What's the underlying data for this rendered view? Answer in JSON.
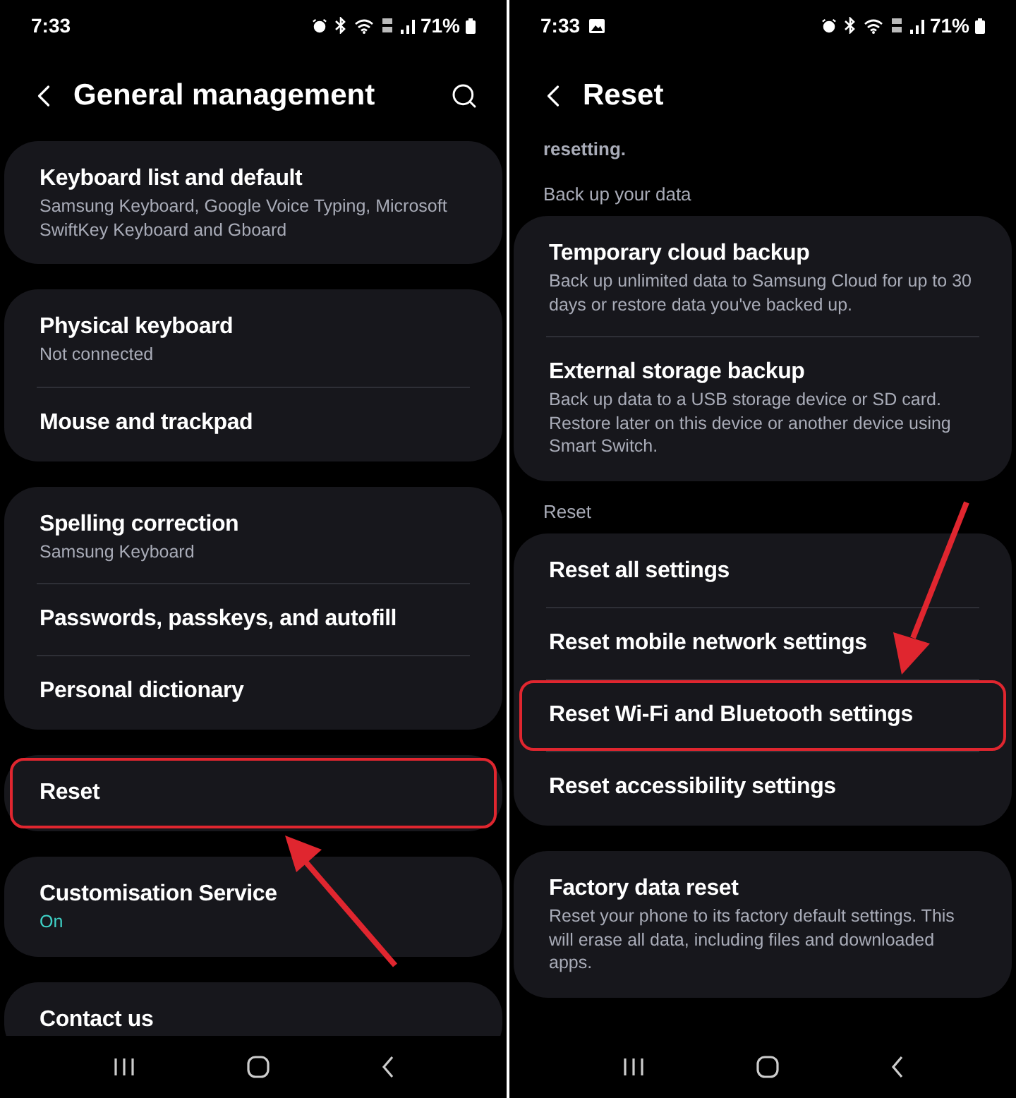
{
  "screens": [
    {
      "status_bar": {
        "time": "7:33",
        "gallery_notification": false,
        "battery": "71%"
      },
      "header": {
        "title": "General management",
        "search": true
      },
      "annotation_arrow": true,
      "content": [
        {
          "kind": "group",
          "items": [
            {
              "title": "Keyboard list and default",
              "subtitle": "Samsung Keyboard, Google Voice Typing, Microsoft SwiftKey Keyboard and Gboard",
              "kind": "info",
              "highlighted": false
            }
          ]
        },
        {
          "kind": "group",
          "items": [
            {
              "title": "Physical keyboard",
              "subtitle": "Not connected",
              "kind": "info",
              "highlighted": false
            },
            {
              "title": "Mouse and trackpad",
              "kind": "info",
              "highlighted": false
            }
          ]
        },
        {
          "kind": "group",
          "items": [
            {
              "title": "Spelling correction",
              "subtitle": "Samsung Keyboard",
              "kind": "info",
              "highlighted": false
            },
            {
              "title": "Passwords, passkeys, and autofill",
              "kind": "info",
              "highlighted": false
            },
            {
              "title": "Personal dictionary",
              "kind": "info",
              "highlighted": false
            }
          ]
        },
        {
          "kind": "group",
          "items": [
            {
              "title": "Reset",
              "kind": "info",
              "highlighted": true
            }
          ]
        },
        {
          "kind": "group",
          "items": [
            {
              "title": "Customisation Service",
              "subtitle": "On",
              "kind": "status",
              "highlighted": false
            }
          ]
        },
        {
          "kind": "group",
          "items": [
            {
              "title": "Contact us",
              "kind": "info",
              "highlighted": false
            }
          ]
        }
      ]
    },
    {
      "status_bar": {
        "time": "7:33",
        "gallery_notification": true,
        "battery": "71%"
      },
      "header": {
        "title": "Reset",
        "search": false
      },
      "annotation_arrow": true,
      "content": [
        {
          "kind": "text",
          "text": "resetting."
        },
        {
          "kind": "section",
          "text": "Back up your data"
        },
        {
          "kind": "group",
          "items": [
            {
              "title": "Temporary cloud backup",
              "subtitle": "Back up unlimited data to Samsung Cloud for up to 30 days or restore data you've backed up.",
              "kind": "info",
              "highlighted": false
            },
            {
              "title": "External storage backup",
              "subtitle": "Back up data to a USB storage device or SD card. Restore later on this device or another device using Smart Switch.",
              "kind": "info",
              "highlighted": false
            }
          ]
        },
        {
          "kind": "section",
          "text": "Reset"
        },
        {
          "kind": "group",
          "items": [
            {
              "title": "Reset all settings",
              "kind": "info",
              "highlighted": false
            },
            {
              "title": "Reset mobile network settings",
              "kind": "info",
              "highlighted": false
            },
            {
              "title": "Reset Wi-Fi and Bluetooth settings",
              "kind": "info",
              "highlighted": true
            },
            {
              "title": "Reset accessibility settings",
              "kind": "info",
              "highlighted": false
            }
          ]
        },
        {
          "kind": "group",
          "items": [
            {
              "title": "Factory data reset",
              "subtitle": "Reset your phone to its factory default settings. This will erase all data, including files and downloaded apps.",
              "kind": "info",
              "highlighted": false
            }
          ]
        }
      ]
    }
  ]
}
